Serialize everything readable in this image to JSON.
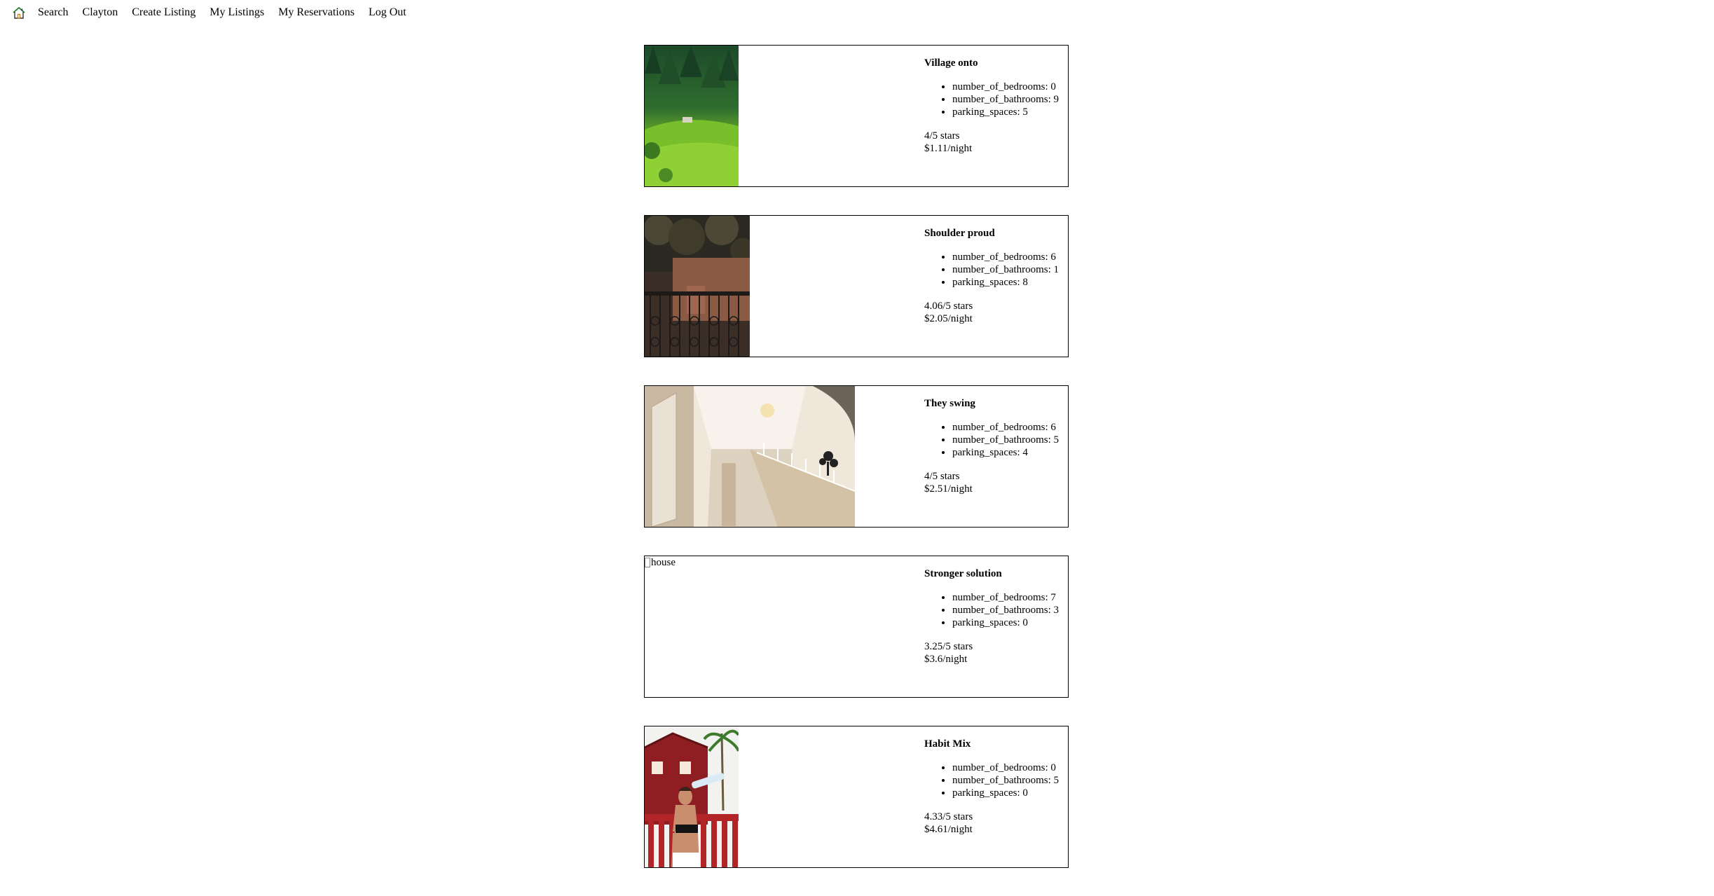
{
  "nav": {
    "home_icon": "home-icon",
    "links": [
      "Search",
      "Clayton",
      "Create Listing",
      "My Listings",
      "My Reservations",
      "Log Out"
    ]
  },
  "listings": [
    {
      "title": "Village onto",
      "image": "forest-hillside-photo",
      "bedrooms": "number_of_bedrooms: 0",
      "bathrooms": "number_of_bathrooms: 9",
      "parking": "parking_spaces: 5",
      "rating": "4/5 stars",
      "price": "$1.11/night"
    },
    {
      "title": "Shoulder proud",
      "image": "iron-gate-photo",
      "bedrooms": "number_of_bedrooms: 6",
      "bathrooms": "number_of_bathrooms: 1",
      "parking": "parking_spaces: 8",
      "rating": "4.06/5 stars",
      "price": "$2.05/night"
    },
    {
      "title": "They swing",
      "image": "staircase-interior-photo",
      "bedrooms": "number_of_bedrooms: 6",
      "bathrooms": "number_of_bathrooms: 5",
      "parking": "parking_spaces: 4",
      "rating": "4/5 stars",
      "price": "$2.51/night"
    },
    {
      "title": "Stronger solution",
      "image_alt": "house",
      "bedrooms": "number_of_bedrooms: 7",
      "bathrooms": "number_of_bathrooms: 3",
      "parking": "parking_spaces: 0",
      "rating": "3.25/5 stars",
      "price": "$3.6/night"
    },
    {
      "title": "Habit Mix",
      "image": "woman-drinking-red-house-photo",
      "bedrooms": "number_of_bedrooms: 0",
      "bathrooms": "number_of_bathrooms: 5",
      "parking": "parking_spaces: 0",
      "rating": "4.33/5 stars",
      "price": "$4.61/night"
    }
  ]
}
